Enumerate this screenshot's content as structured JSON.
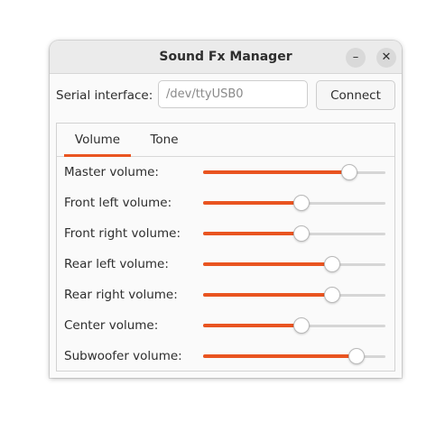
{
  "window": {
    "title": "Sound Fx Manager",
    "minimize_glyph": "–",
    "close_glyph": "✕"
  },
  "serial": {
    "label": "Serial interface:",
    "placeholder": "/dev/ttyUSB0",
    "value": "",
    "connect_label": "Connect"
  },
  "tabs": [
    {
      "label": "Volume",
      "active": true
    },
    {
      "label": "Tone",
      "active": false
    }
  ],
  "volumes": [
    {
      "label": "Master volume:",
      "level": 0.8
    },
    {
      "label": "Front left volume:",
      "level": 0.54
    },
    {
      "label": "Front right volume:",
      "level": 0.54
    },
    {
      "label": "Rear left volume:",
      "level": 0.71
    },
    {
      "label": "Rear right volume:",
      "level": 0.71
    },
    {
      "label": "Center volume:",
      "level": 0.54
    },
    {
      "label": "Subwoofer volume:",
      "level": 0.84
    }
  ],
  "colors": {
    "accent": "#e95420",
    "track": "#d6d6d6"
  }
}
